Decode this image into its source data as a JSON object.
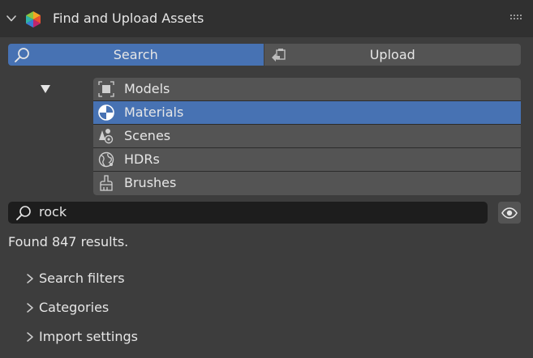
{
  "header": {
    "title": "Find and Upload Assets",
    "collapse_icon": "chevron-down-icon",
    "logo_icon": "blenderkit-logo-icon",
    "grip_icon": "drag-grip-icon"
  },
  "tabs": [
    {
      "label": "Search",
      "icon": "search-icon",
      "selected": true
    },
    {
      "label": "Upload",
      "icon": "upload-icon",
      "selected": false
    }
  ],
  "asset_types": [
    {
      "label": "Models",
      "icon": "model-icon",
      "selected": false
    },
    {
      "label": "Materials",
      "icon": "material-icon",
      "selected": true
    },
    {
      "label": "Scenes",
      "icon": "scene-icon",
      "selected": false
    },
    {
      "label": "HDRs",
      "icon": "world-icon",
      "selected": false
    },
    {
      "label": "Brushes",
      "icon": "brush-icon",
      "selected": false
    }
  ],
  "search": {
    "value": "rock",
    "icon": "search-icon"
  },
  "status": {
    "results_text": "Found 847 results."
  },
  "sections": [
    {
      "label": "Search filters",
      "expanded": false
    },
    {
      "label": "Categories",
      "expanded": false
    },
    {
      "label": "Import settings",
      "expanded": false
    }
  ],
  "colors": {
    "accent": "#4772b3",
    "panel_bg": "#3d3d3d",
    "header_bg": "#303030",
    "button_bg": "#545454",
    "input_bg": "#1d1d1d"
  }
}
